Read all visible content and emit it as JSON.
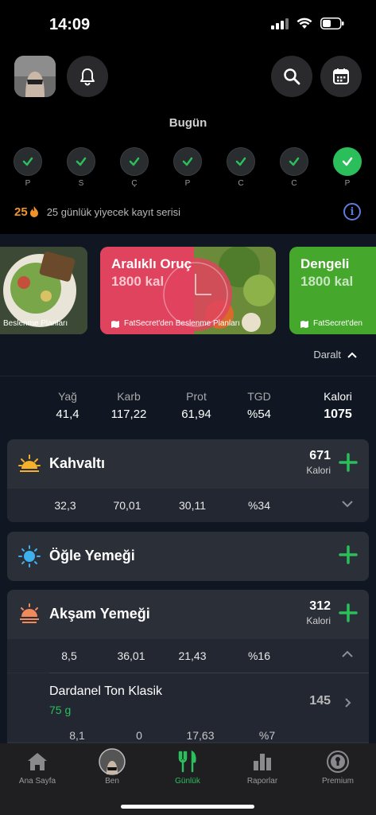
{
  "status_bar": {
    "time": "14:09"
  },
  "header": {
    "today_label": "Bugün"
  },
  "days": [
    {
      "label": "P",
      "checked": true
    },
    {
      "label": "S",
      "checked": true
    },
    {
      "label": "Ç",
      "checked": true
    },
    {
      "label": "P",
      "checked": true
    },
    {
      "label": "C",
      "checked": true
    },
    {
      "label": "C",
      "checked": true
    },
    {
      "label": "P",
      "checked": true,
      "active": true
    }
  ],
  "streak": {
    "count": "25",
    "text": "25 günlük yiyecek kayıt serisi"
  },
  "plans": [
    {
      "title": "",
      "kcal": "",
      "footer": "Beslenme Planları"
    },
    {
      "title": "Aralıklı Oruç",
      "kcal": "1800 kal",
      "footer": "FatSecret'den Beslenme Planları"
    },
    {
      "title": "Dengeli",
      "kcal": "1800 kal",
      "footer": "FatSecret'den"
    }
  ],
  "collapse_label": "Daralt",
  "summary": {
    "fat": {
      "label": "Yağ",
      "value": "41,4"
    },
    "carb": {
      "label": "Karb",
      "value": "117,22"
    },
    "prot": {
      "label": "Prot",
      "value": "61,94"
    },
    "rdi": {
      "label": "TGD",
      "value": "%54"
    },
    "cal": {
      "label": "Kalori",
      "value": "1075"
    }
  },
  "meals": {
    "breakfast": {
      "name": "Kahvaltı",
      "kcal": "671",
      "kcal_unit": "Kalori",
      "macros": [
        "32,3",
        "70,01",
        "30,11",
        "%34"
      ]
    },
    "lunch": {
      "name": "Öğle Yemeği"
    },
    "dinner": {
      "name": "Akşam Yemeği",
      "kcal": "312",
      "kcal_unit": "Kalori",
      "macros": [
        "8,5",
        "36,01",
        "21,43",
        "%16"
      ],
      "items": [
        {
          "name": "Dardanel Ton Klasik",
          "amount": "75 g",
          "kcal": "145",
          "macros": [
            "8,1",
            "0",
            "17,63",
            "%7"
          ]
        }
      ]
    }
  },
  "tabs": [
    {
      "label": "Ana Sayfa",
      "icon": "home-icon"
    },
    {
      "label": "Ben",
      "icon": "avatar-icon"
    },
    {
      "label": "Günlük",
      "icon": "fork-knife-icon",
      "active": true
    },
    {
      "label": "Raporlar",
      "icon": "bar-chart-icon"
    },
    {
      "label": "Premium",
      "icon": "premium-badge-icon"
    }
  ],
  "colors": {
    "accent": "#2bbf5c",
    "streak": "#f0932b",
    "info": "#5f7ad8"
  }
}
